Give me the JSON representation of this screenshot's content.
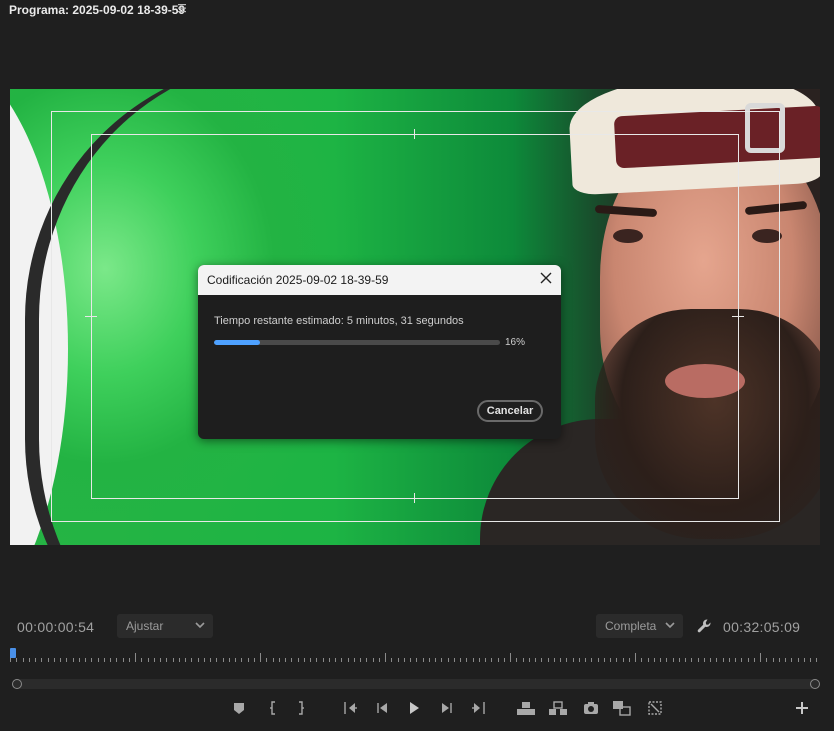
{
  "panel": {
    "title": "Programa: 2025-09-02 18-39-59",
    "menu_icon": "hamburger-menu-icon"
  },
  "dialog": {
    "title": "Codificación 2025-09-02 18-39-59",
    "status": "Tiempo restante estimado: 5 minutos, 31 segundos",
    "progress_fraction": 0.16,
    "progress_label": "16%",
    "cancel_label": "Cancelar",
    "close_icon": "close-icon",
    "accent_color": "#4ea1ff"
  },
  "controls": {
    "current_timecode": "00:00:00:54",
    "zoom_value": "Ajustar",
    "resolution_value": "Completa",
    "duration_timecode": "00:32:05:09"
  },
  "transport_icons": [
    "add-marker-icon",
    "mark-in-icon",
    "mark-out-icon",
    "go-to-in-icon",
    "step-back-icon",
    "play-icon",
    "step-forward-icon",
    "go-to-out-icon",
    "lift-icon",
    "extract-icon",
    "export-frame-icon",
    "comparison-view-icon",
    "proxy-toggle-icon",
    "add-button-icon"
  ]
}
